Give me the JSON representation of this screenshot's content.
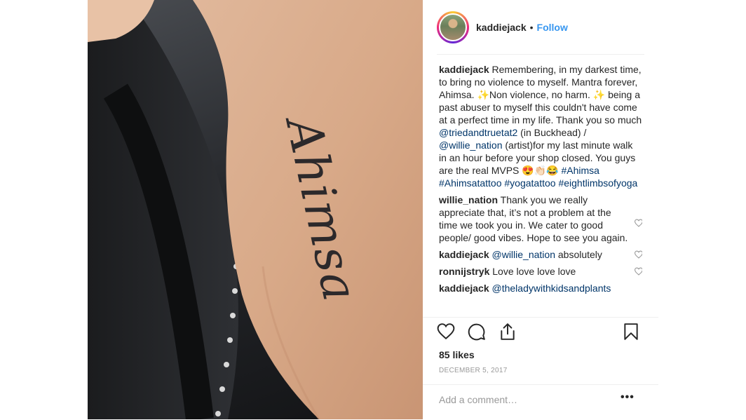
{
  "post": {
    "username": "kaddiejack",
    "follow_label": "Follow",
    "separator": "•",
    "tattoo_text": "Ahimsa",
    "likes": "85 likes",
    "date": "DECEMBER 5, 2017",
    "add_comment_placeholder": "Add a comment…",
    "more_label": "•••"
  },
  "caption": {
    "user": "kaddiejack",
    "t1": " Remembering, in my darkest time, to bring no violence to myself. Mantra forever, Ahimsa. ✨Non violence, no harm. ✨ being a past abuser to myself this couldn't have come at a perfect time in my life. Thank you so much ",
    "mention1": "@triedandtruetat2",
    "t2": " (in Buckhead) / ",
    "mention2": "@willie_nation",
    "t3": " (artist)for my last minute walk in an hour before your shop closed. You guys are the real MVPS 😍👏🏻😂 ",
    "tag1": "#Ahimsa",
    "tag2": "#Ahimsatattoo",
    "tag3": "#yogatattoo",
    "tag4": "#eightlimbsofyoga"
  },
  "comments": [
    {
      "user": "willie_nation",
      "text": " Thank you we really appreciate that, it’s not a problem at the time we took you in. We cater to good people/ good vibes. Hope to see you again."
    },
    {
      "user": "kaddiejack",
      "mention": "@willie_nation",
      "text": " absolutely"
    },
    {
      "user": "ronnijstryk",
      "text": " Love love love love"
    },
    {
      "user": "kaddiejack",
      "mention": "@theladywithkidsandplants",
      "text": ""
    }
  ],
  "icons": {
    "like": "heart-icon",
    "comment": "comment-icon",
    "share": "share-icon",
    "save": "bookmark-icon",
    "comment_like": "heart-icon"
  },
  "colors": {
    "follow": "#3897f0",
    "link": "#003569",
    "text": "#262626",
    "muted": "#999999"
  }
}
